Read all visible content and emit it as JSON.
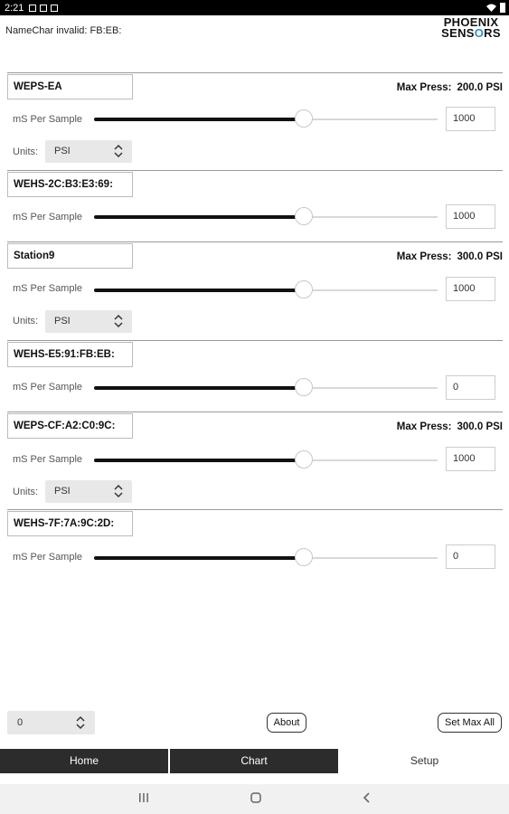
{
  "status": {
    "time": "2:21"
  },
  "header": {
    "message": "NameChar invalid: FB:EB:",
    "logo_line1": "PHOENIX",
    "logo_line2_a": "SENS",
    "logo_line2_b": "RS"
  },
  "labels": {
    "ms_per_sample": "mS Per Sample",
    "units": "Units:",
    "max_press": "Max Press:"
  },
  "sensors": [
    {
      "name": "WEPS-EA",
      "max_press": "200.0 PSI",
      "ms": "1000",
      "units": "PSI",
      "slider": 0.61
    },
    {
      "name": "WEHS-2C:B3:E3:69:",
      "ms": "1000",
      "slider": 0.61
    },
    {
      "name": "Station9",
      "max_press": "300.0 PSI",
      "ms": "1000",
      "units": "PSI",
      "slider": 0.61
    },
    {
      "name": "WEHS-E5:91:FB:EB:",
      "ms": "0",
      "slider": 0.61
    },
    {
      "name": "WEPS-CF:A2:C0:9C:",
      "max_press": "300.0 PSI",
      "ms": "1000",
      "units": "PSI",
      "slider": 0.61
    },
    {
      "name": "WEHS-7F:7A:9C:2D:",
      "ms": "0",
      "slider": 0.61
    }
  ],
  "footer": {
    "select_value": "0",
    "about_label": "About",
    "set_max_label": "Set Max All"
  },
  "tabs": [
    "Home",
    "Chart",
    "Setup"
  ]
}
